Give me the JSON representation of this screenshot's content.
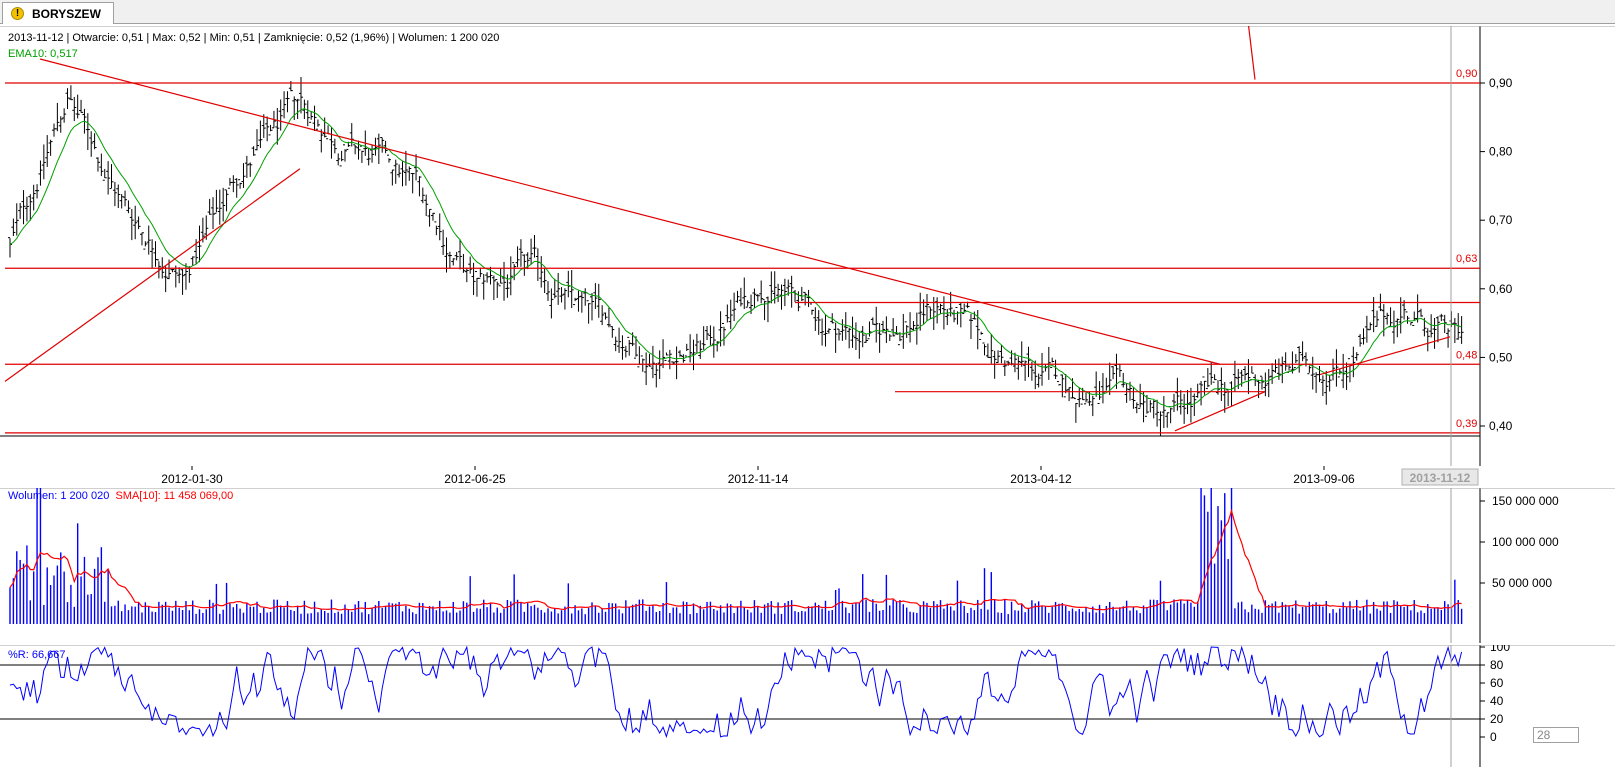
{
  "tab": {
    "title": "BORYSZEW",
    "icon": "warning-icon"
  },
  "info_line": "2013-11-12 | Otwarcie: 0,51 | Max: 0,52 | Min: 0,51 | Zamknięcie: 0,52 (1,96%)  | Wolumen: 1 200 020",
  "ema_label": "EMA10: 0,517",
  "volume_legend": {
    "volume": "Wolumen: 1 200 020",
    "sma": "SMA[10]: 11 458 069,00"
  },
  "wr_label": "%R: 66,667",
  "cursor_date": "2013-11-12",
  "scroll_value": "28",
  "colors": {
    "bars": "#000000",
    "ema": "#00a000",
    "lines": "#e00000",
    "volume": "#0000ff",
    "sma": "#ff0000",
    "wr": "#0000ff"
  },
  "price_axis": {
    "ticks": [
      {
        "v": 0.9,
        "label": "0,90"
      },
      {
        "v": 0.8,
        "label": "0,80"
      },
      {
        "v": 0.7,
        "label": "0,70"
      },
      {
        "v": 0.6,
        "label": "0,60"
      },
      {
        "v": 0.5,
        "label": "0,50"
      },
      {
        "v": 0.4,
        "label": "0,40"
      }
    ]
  },
  "level_labels": [
    {
      "v": 0.9,
      "label": "0,90"
    },
    {
      "v": 0.63,
      "label": "0,63"
    },
    {
      "v": 0.49,
      "label": "0,48"
    },
    {
      "v": 0.39,
      "label": "0,39"
    }
  ],
  "date_axis": [
    "2012-01-30",
    "2012-06-25",
    "2012-11-14",
    "2013-04-12",
    "2013-09-06"
  ],
  "volume_axis": [
    "150 000 000",
    "100 000 000",
    "50 000 000"
  ],
  "wr_axis": [
    "100",
    "80",
    "60",
    "40",
    "20",
    "0"
  ],
  "chart_data": [
    {
      "type": "ohlc",
      "name": "BORYSZEW",
      "x": [
        "2011-10",
        "2011-11",
        "2011-12",
        "2012-01",
        "2012-02",
        "2012-03",
        "2012-04",
        "2012-05",
        "2012-06",
        "2012-07",
        "2012-08",
        "2012-09",
        "2012-10",
        "2012-11",
        "2012-12",
        "2013-01",
        "2013-02",
        "2013-03",
        "2013-04",
        "2013-05",
        "2013-06",
        "2013-07",
        "2013-08",
        "2013-09",
        "2013-10",
        "2013-11"
      ],
      "close": [
        0.66,
        0.88,
        0.72,
        0.62,
        0.78,
        0.86,
        0.8,
        0.75,
        0.6,
        0.62,
        0.56,
        0.51,
        0.52,
        0.62,
        0.55,
        0.53,
        0.58,
        0.5,
        0.46,
        0.44,
        0.41,
        0.45,
        0.48,
        0.5,
        0.57,
        0.52
      ],
      "ema": {
        "name": "EMA10",
        "last": 0.517
      },
      "ylim": [
        0.38,
        0.96
      ],
      "horizontal_levels": [
        0.9,
        0.63,
        0.58,
        0.49,
        0.45,
        0.39
      ]
    },
    {
      "type": "bar",
      "name": "Wolumen",
      "note_sma": "SMA[10]",
      "peaks_millions": [
        {
          "date": "2011-10",
          "v": 110
        },
        {
          "date": "2012-12",
          "v": 70
        },
        {
          "date": "2013-04",
          "v": 170
        },
        {
          "date": "2013-11",
          "v": 45
        }
      ],
      "ylim": [
        0,
        175000000
      ]
    },
    {
      "type": "line",
      "name": "%R",
      "last": 66.667,
      "ylim": [
        0,
        100
      ],
      "reference_lines": [
        80,
        20
      ]
    }
  ]
}
